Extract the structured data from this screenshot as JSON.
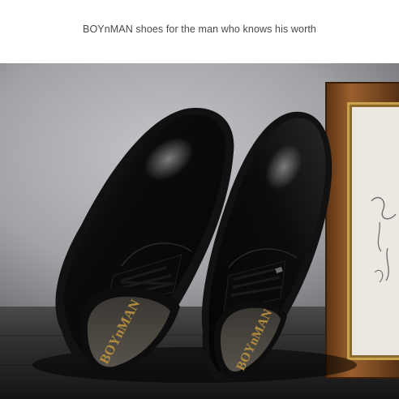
{
  "banner": {
    "tagline": "BOYnMAN shoes for the man who knows his worth"
  },
  "product_photo": {
    "insole_brand_left": "BOYnMAN",
    "insole_brand_right": "BOYnMAN",
    "colors": {
      "wall_light": "#b8b9bd",
      "wall_dark": "#6a6b6f",
      "floor": "#2e2e2e",
      "leather": "#0d0d0d",
      "frame_wood": "#7a4a22",
      "frame_gold": "#c9a24e",
      "insole": "#4a463f",
      "brand_gold": "#b08a3e"
    }
  }
}
